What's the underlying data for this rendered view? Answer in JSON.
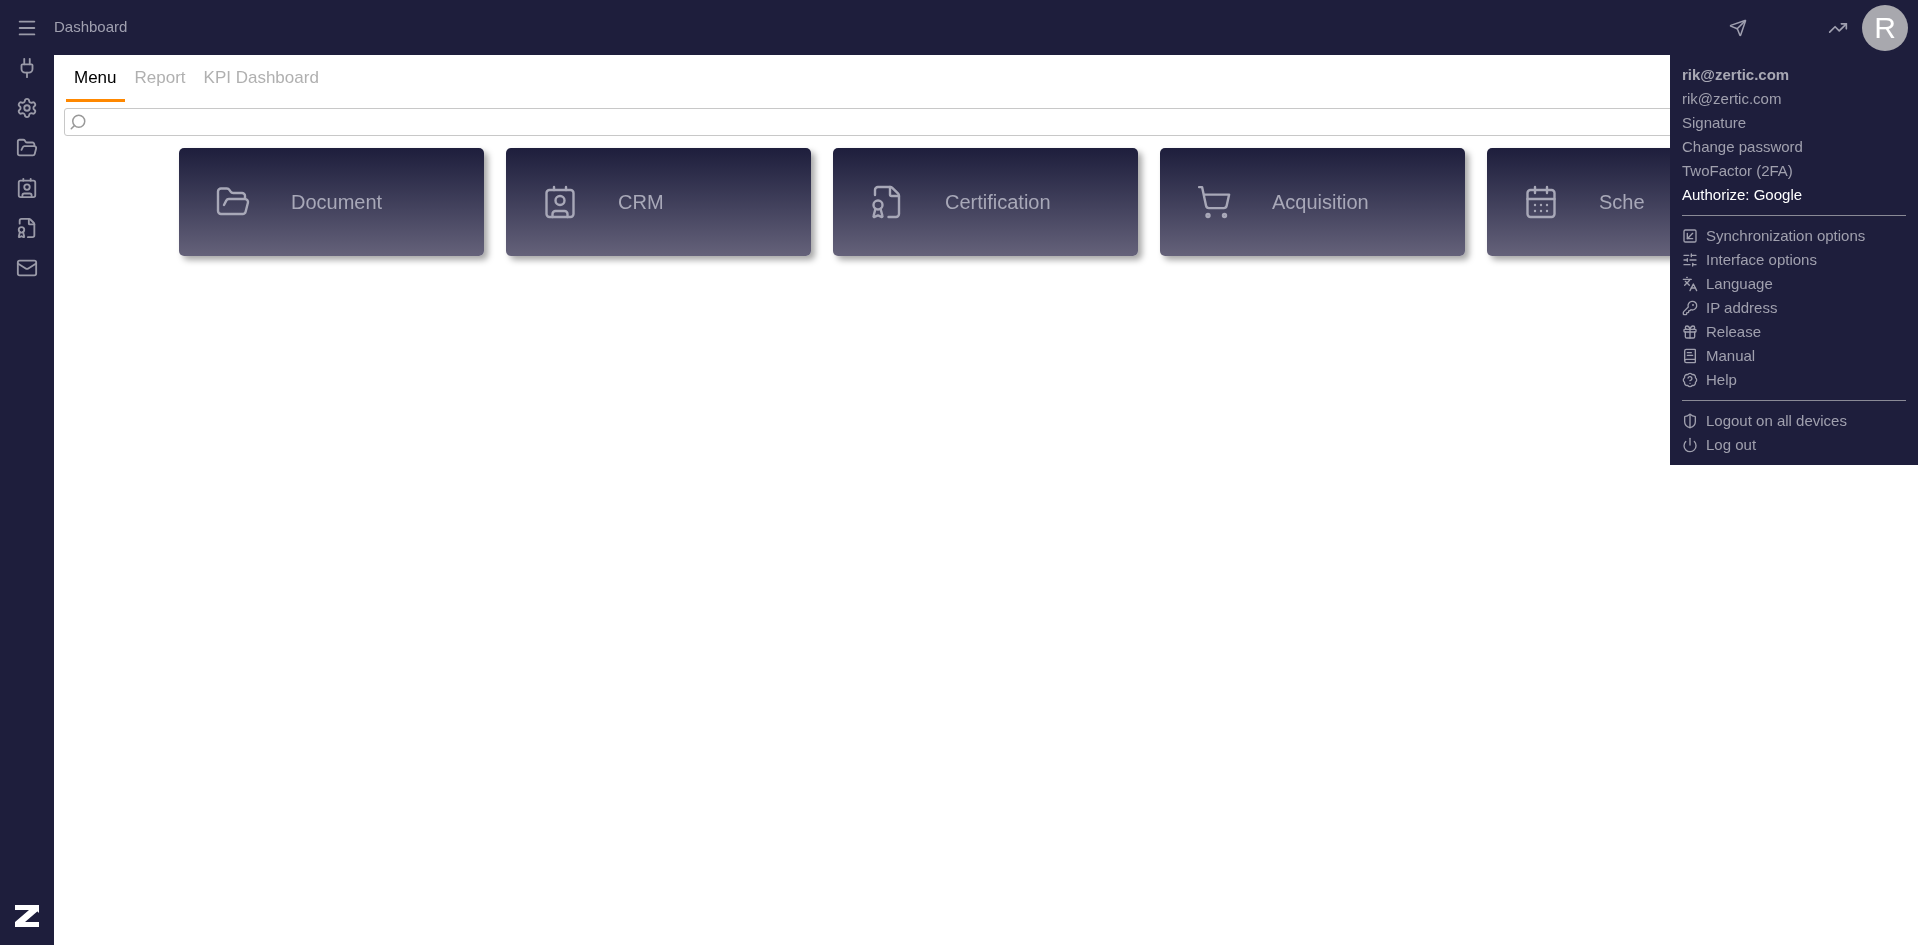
{
  "header": {
    "title": "Dashboard",
    "avatar_initial": "R"
  },
  "tabs": [
    {
      "label": "Menu",
      "selected": true
    },
    {
      "label": "Report",
      "selected": false
    },
    {
      "label": "KPI Dashboard",
      "selected": false
    }
  ],
  "tiles": [
    {
      "label": "Document"
    },
    {
      "label": "CRM"
    },
    {
      "label": "Certification"
    },
    {
      "label": "Acquisition"
    },
    {
      "label": "Sche"
    }
  ],
  "account_menu": {
    "user": "rik@zertic.com",
    "items": [
      {
        "label": "rik@zertic.com",
        "highlighted": false
      },
      {
        "label": "Signature",
        "highlighted": false
      },
      {
        "label": "Change password",
        "highlighted": false
      },
      {
        "label": "TwoFactor (2FA)",
        "highlighted": false
      },
      {
        "label": "Authorize: Google",
        "highlighted": true
      }
    ],
    "options": [
      "Synchronization options",
      "Interface options",
      "Language",
      "IP address",
      "Release",
      "Manual",
      "Help"
    ],
    "session": [
      "Logout on all devices",
      "Log out"
    ]
  }
}
